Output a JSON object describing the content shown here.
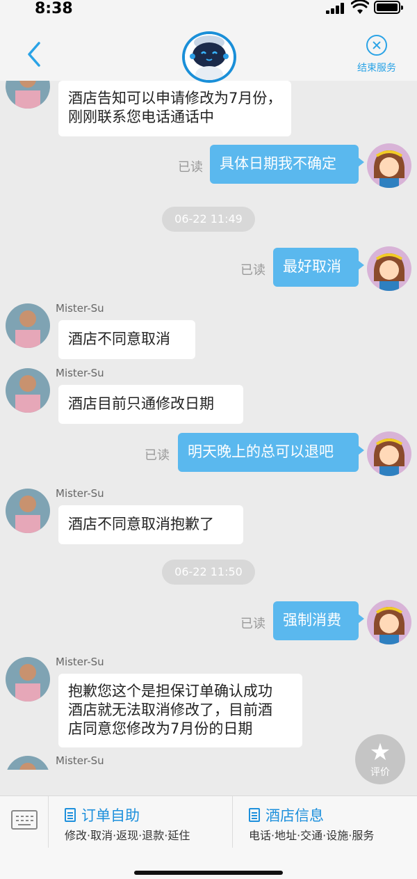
{
  "status_bar": {
    "time": "8:38"
  },
  "header": {
    "end_service_label": "结束服务"
  },
  "messages": [
    {
      "text_line1": "酒店告知可以申请修改为7月份，",
      "text_line2": "刚刚联系您电话通话中"
    },
    {
      "text": "具体日期我不确定",
      "read": "已读"
    },
    {
      "time": "06-22 11:49"
    },
    {
      "text": "最好取消",
      "read": "已读"
    },
    {
      "sender": "Mister-Su",
      "text": "酒店不同意取消"
    },
    {
      "sender": "Mister-Su",
      "text": "酒店目前只通修改日期"
    },
    {
      "text": "明天晚上的总可以退吧",
      "read": "已读"
    },
    {
      "sender": "Mister-Su",
      "text": "酒店不同意取消抱歉了"
    },
    {
      "time": "06-22 11:50"
    },
    {
      "text": "强制消费",
      "read": "已读"
    },
    {
      "sender": "Mister-Su",
      "text_line1": "抱歉您这个是担保订单确认成功",
      "text_line2": "酒店就无法取消修改了，目前酒",
      "text_line3": "店同意您修改为7月份的日期"
    },
    {
      "sender": "Mister-Su"
    }
  ],
  "rate_button": {
    "label": "评价"
  },
  "bottom_menu": {
    "order_title": "订单自助",
    "order_sub": "修改·取消·返现·退款·延住",
    "hotel_title": "酒店信息",
    "hotel_sub": "电话·地址·交通·设施·服务"
  },
  "icons": {
    "back": "chevron-left-icon",
    "close": "close-circle-icon",
    "star": "star-icon",
    "keyboard": "keyboard-icon",
    "doc": "document-icon"
  },
  "colors": {
    "accent": "#1e90dc",
    "bubble_out": "#5ab8ee",
    "background": "#ebebeb"
  }
}
